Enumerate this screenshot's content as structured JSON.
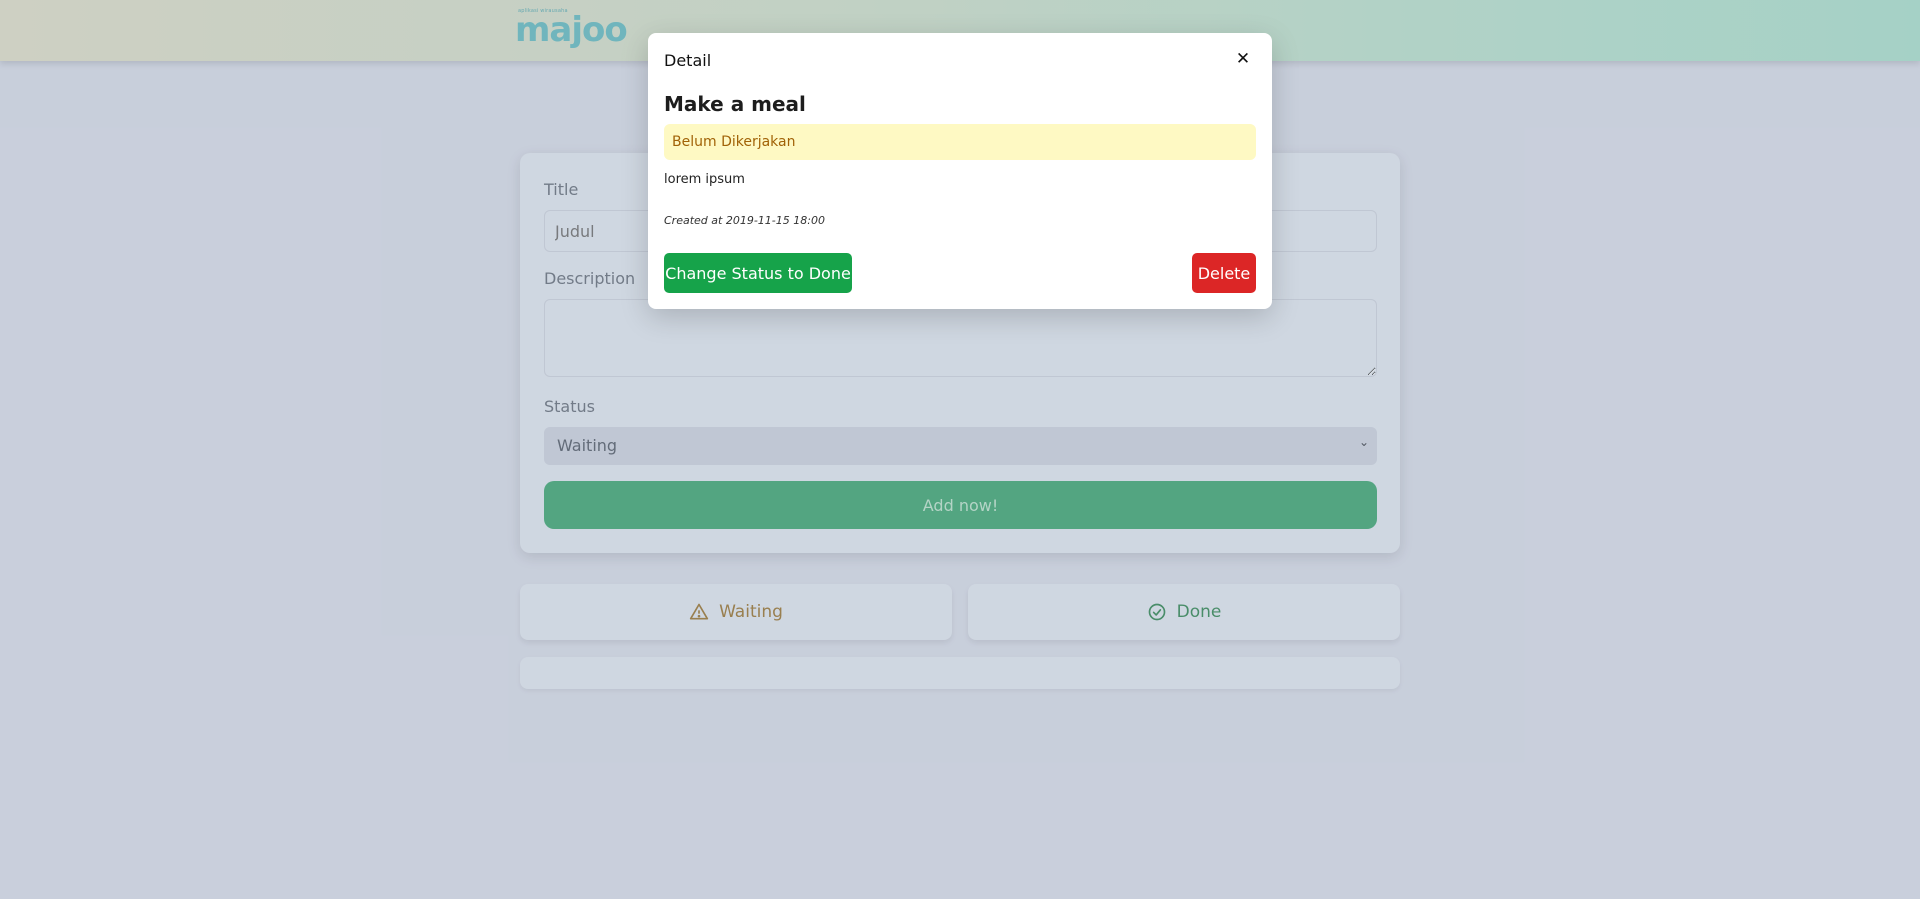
{
  "header": {
    "logo_tagline": "aplikasi wirausaha",
    "logo_text": "majoo"
  },
  "form": {
    "title_label": "Title",
    "title_placeholder": "Judul",
    "description_label": "Description",
    "description_value": "",
    "status_label": "Status",
    "status_selected": "Waiting",
    "submit_label": "Add now!"
  },
  "tabs": {
    "waiting_label": "Waiting",
    "done_label": "Done"
  },
  "modal": {
    "heading": "Detail",
    "close_glyph": "✕",
    "task_title": "Make a meal",
    "status_text": "Belum Dikerjakan",
    "description": "lorem ipsum",
    "created_at": "Created at 2019-11-15 18:00",
    "change_status_label": "Change Status to Done",
    "delete_label": "Delete"
  },
  "colors": {
    "status_pill_bg": "#fef9c3",
    "status_pill_text": "#a16207",
    "done_button": "#16a34a",
    "delete_button": "#dc2626",
    "add_button": "#4aa679"
  },
  "icons": {
    "waiting": "warning-triangle-icon",
    "done": "check-circle-icon",
    "close": "close-icon",
    "select": "chevron-down-icon"
  }
}
